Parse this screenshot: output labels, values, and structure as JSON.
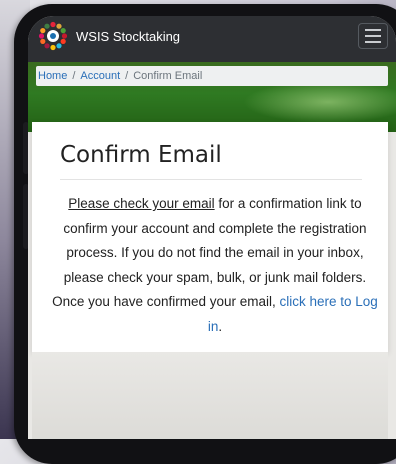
{
  "navbar": {
    "brand": "WSIS Stocktaking",
    "logo_icon": "wsis-logo-icon",
    "menu_icon": "hamburger-menu-icon"
  },
  "breadcrumb": {
    "items": [
      "Home",
      "Account",
      "Confirm Email"
    ],
    "separator": "/"
  },
  "card": {
    "title": "Confirm Email",
    "message_underlined": "Please check your email",
    "message_body": " for a confirmation link to confirm your account and complete the registration process. If you do not find the email in your inbox, please check your spam, bulk, or junk mail folders. Once you have confirmed your email, ",
    "login_link": "click here to Log in",
    "message_end": "."
  },
  "colors": {
    "navbar_bg": "#2d2f33",
    "link": "#2a6fb8",
    "hero_green": "#2f7a22"
  }
}
